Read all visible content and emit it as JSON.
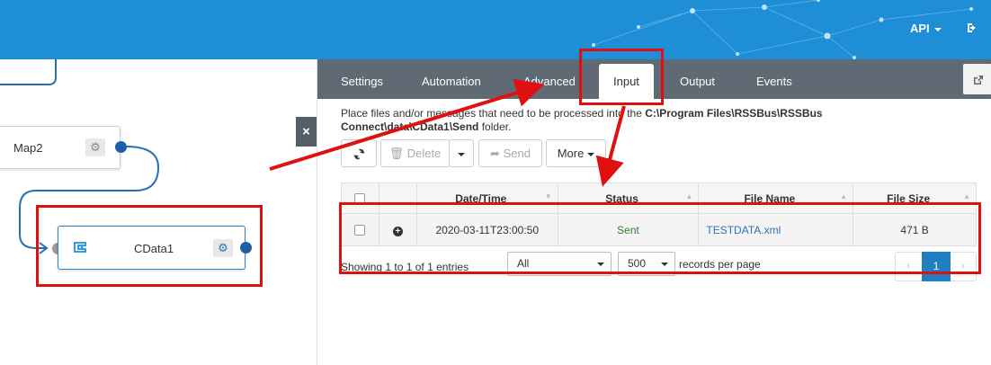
{
  "header": {
    "api_label": "API",
    "logout_icon": "logout-icon",
    "bg_color": "#1e8fd6"
  },
  "flow": {
    "nodes": [
      {
        "label": "Map2",
        "icon": "gear-icon"
      },
      {
        "label": "CData1",
        "icon": "gear-icon",
        "logo": "cdata-logo"
      }
    ],
    "close_label": "×"
  },
  "panel": {
    "tabs": [
      {
        "label": "Settings"
      },
      {
        "label": "Automation"
      },
      {
        "label": "Advanced"
      },
      {
        "label": "Input",
        "active": true
      },
      {
        "label": "Output"
      },
      {
        "label": "Events"
      }
    ],
    "info_prefix": "Place files and/or messages that need to be processed into the",
    "info_path": "C:\\Program Files\\RSSBus\\RSSBus Connect\\data\\CData1\\Send",
    "info_suffix": "folder.",
    "toolbar": {
      "delete_label": "Delete",
      "send_label": "Send",
      "more_label": "More"
    },
    "table": {
      "columns": [
        "Date/Time",
        "Status",
        "File Name",
        "File Size"
      ],
      "rows": [
        {
          "datetime": "2020-03-11T23:00:50",
          "status": "Sent",
          "file_name": "TESTDATA.xml",
          "file_size": "471 B"
        }
      ]
    },
    "footer": {
      "showing": "Showing 1 to 1 of 1 entries",
      "filter_value": "All",
      "page_size": "500",
      "per_page_label": "records per page",
      "prev_label": "‹",
      "current_page": "1",
      "next_label": "›"
    }
  },
  "annotation_color": "#e01010"
}
